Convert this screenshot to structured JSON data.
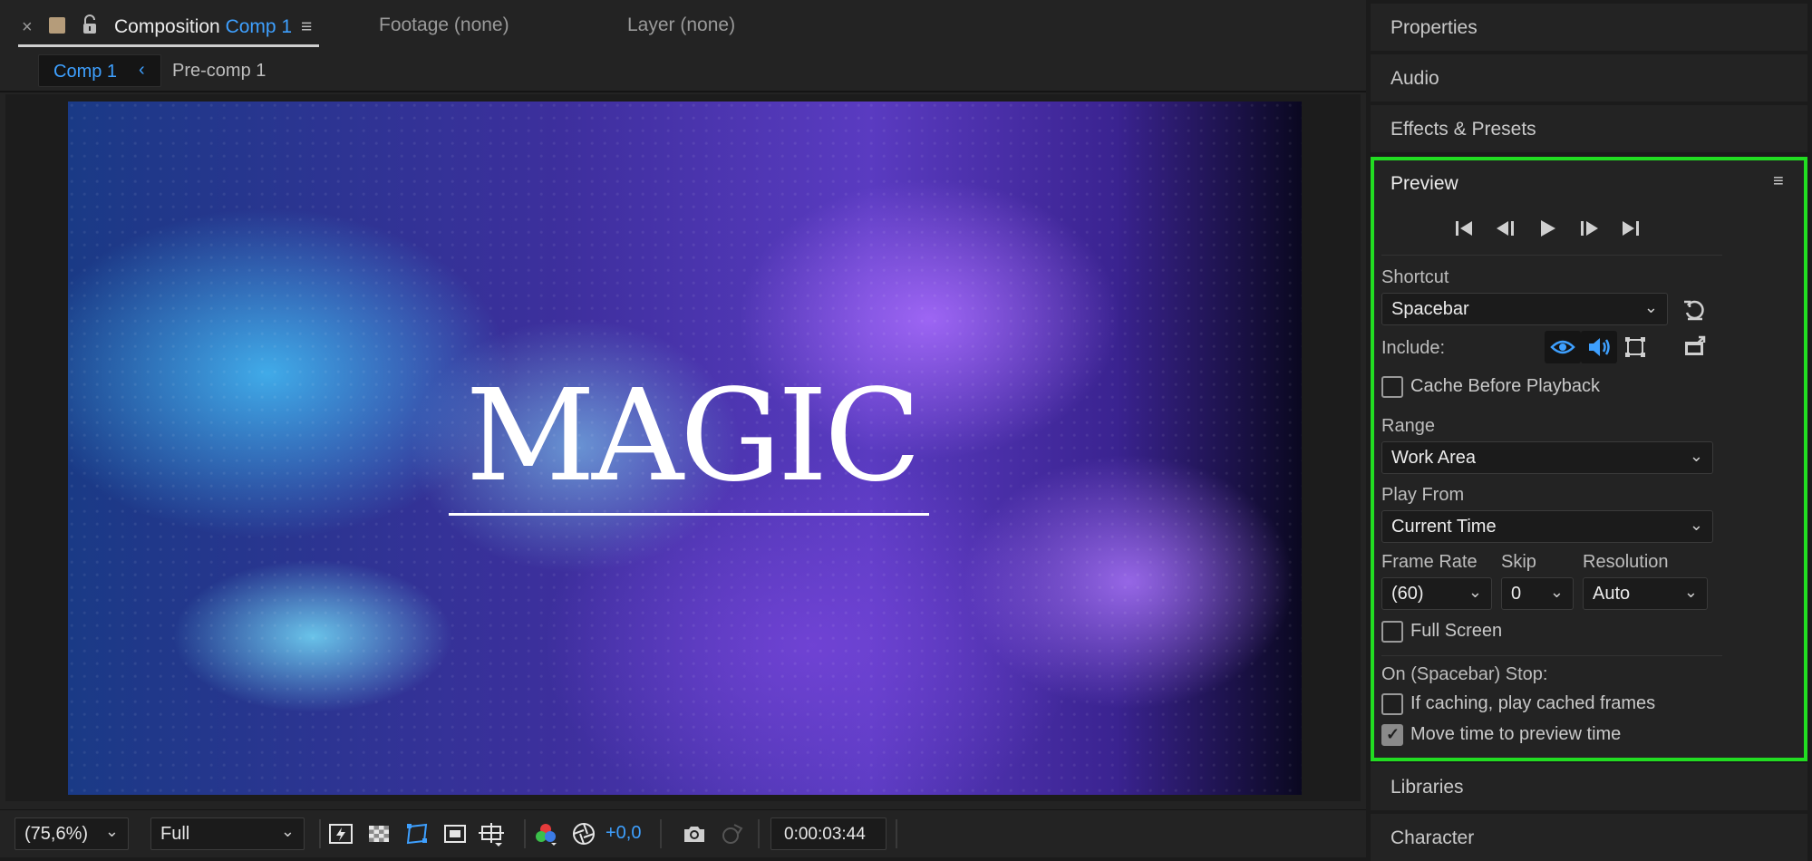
{
  "composition_panel": {
    "tabs": {
      "close": "×",
      "composition_label": "Composition",
      "composition_name": "Comp 1",
      "menu": "≡",
      "footage": "Footage (none)",
      "layer": "Layer (none)"
    },
    "flowchart": {
      "current": "Comp 1",
      "chevron": "‹",
      "next": "Pre-comp 1"
    },
    "canvas": {
      "title_text": "MAGIC"
    },
    "toolbar": {
      "zoom": "(75,6%)",
      "resolution": "Full",
      "exposure": "+0,0",
      "timecode": "0:00:03:44",
      "icons": [
        "fast-previews-icon",
        "transparency-grid-icon",
        "mask-path-visibility-icon",
        "region-of-interest-icon",
        "grid-guides-icon",
        "channel-icon",
        "reset-exposure-icon",
        "snapshot-icon",
        "show-snapshot-icon"
      ]
    }
  },
  "right_panels": {
    "properties": "Properties",
    "audio": "Audio",
    "effects": "Effects & Presets",
    "libraries": "Libraries",
    "character": "Character"
  },
  "preview": {
    "title": "Preview",
    "menu": "≡",
    "transport_icons": [
      "first-frame-icon",
      "previous-frame-icon",
      "play-icon",
      "next-frame-icon",
      "last-frame-icon"
    ],
    "shortcut_label": "Shortcut",
    "shortcut_value": "Spacebar",
    "include_label": "Include:",
    "include_icons": [
      "video-eye-icon",
      "audio-speaker-icon",
      "overlays-icon",
      "external-output-icon"
    ],
    "cache_before_playback": "Cache Before Playback",
    "range_label": "Range",
    "range_value": "Work Area",
    "play_from_label": "Play From",
    "play_from_value": "Current Time",
    "frame_rate_label": "Frame Rate",
    "frame_rate_value": "(60)",
    "skip_label": "Skip",
    "skip_value": "0",
    "resolution_label": "Resolution",
    "resolution_value": "Auto",
    "full_screen": "Full Screen",
    "on_stop_label": "On (Spacebar) Stop:",
    "if_caching": "If caching, play cached frames",
    "move_time": "Move time to preview time",
    "checkbox_states": {
      "cache_before_playback": false,
      "full_screen": false,
      "if_caching": false,
      "move_time": true
    },
    "highlight_color": "#22dd22",
    "accent_color": "#3ea0ff"
  }
}
